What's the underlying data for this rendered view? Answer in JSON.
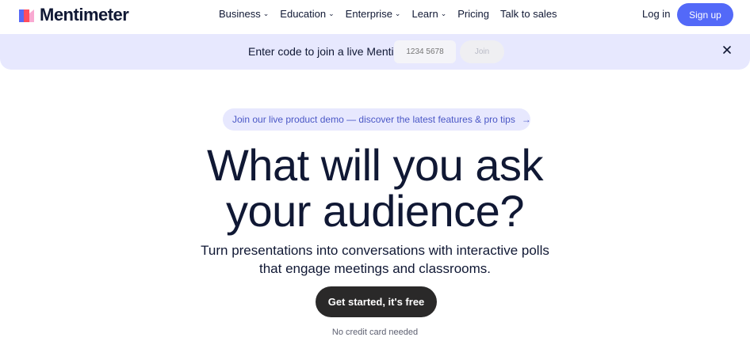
{
  "brand": {
    "name": "Mentimeter",
    "colors": {
      "accent": "#5369f8",
      "logo_red": "#ff4d5e",
      "logo_blue": "#5769f6",
      "logo_pink": "#f9a9d1",
      "banner_bg": "#e7e8fe",
      "cta_bg": "#2a2929"
    }
  },
  "nav": {
    "items": [
      {
        "label": "Business",
        "has_menu": true
      },
      {
        "label": "Education",
        "has_menu": true
      },
      {
        "label": "Enterprise",
        "has_menu": true
      },
      {
        "label": "Learn",
        "has_menu": true
      },
      {
        "label": "Pricing",
        "has_menu": false
      },
      {
        "label": "Talk to sales",
        "has_menu": false
      }
    ],
    "login": "Log in",
    "signup": "Sign up"
  },
  "join_bar": {
    "text": "Enter code to join a live Menti",
    "placeholder": "1234 5678",
    "button": "Join",
    "close_icon": "close-icon"
  },
  "hero": {
    "demo_pill": "Join our live product demo — discover the latest features & pro tips",
    "demo_arrow": "→",
    "headline_line1": "What will you ask",
    "headline_line2": "your audience?",
    "sub_line1": "Turn presentations into conversations with interactive polls",
    "sub_line2": "that engage meetings and classrooms.",
    "cta": "Get started, it's free",
    "note": "No credit card needed"
  }
}
